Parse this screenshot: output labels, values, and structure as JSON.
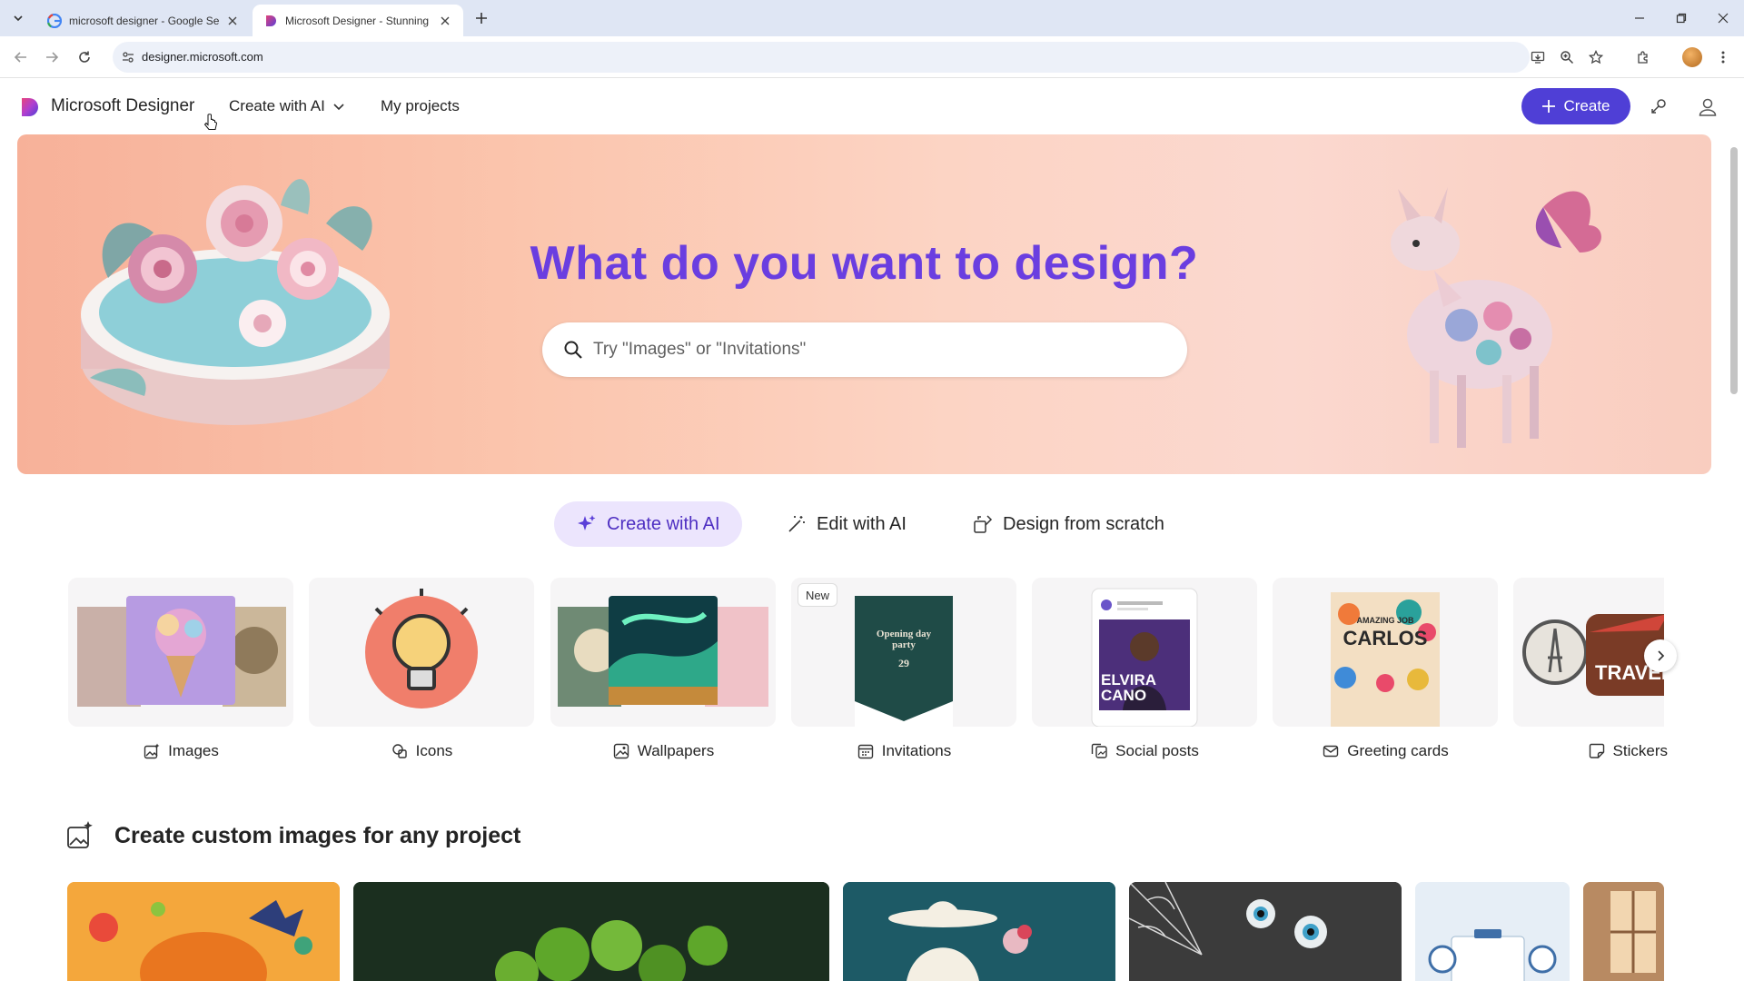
{
  "browser": {
    "tabs": [
      {
        "title": "microsoft designer - Google Se",
        "active": false,
        "favicon": "google-icon"
      },
      {
        "title": "Microsoft Designer - Stunning",
        "active": true,
        "favicon": "designer-icon"
      }
    ],
    "url": "designer.microsoft.com"
  },
  "header": {
    "app_name": "Microsoft Designer",
    "nav": {
      "create_with_ai": "Create with AI",
      "my_projects": "My projects"
    },
    "create_button": "Create"
  },
  "hero": {
    "title": "What do you want to design?",
    "search_placeholder": "Try \"Images\" or \"Invitations\""
  },
  "modes": [
    {
      "label": "Create with AI",
      "active": true,
      "icon": "sparkle-icon"
    },
    {
      "label": "Edit with AI",
      "active": false,
      "icon": "magic-wand-icon"
    },
    {
      "label": "Design from scratch",
      "active": false,
      "icon": "design-scratch-icon"
    }
  ],
  "categories": [
    {
      "label": "Images",
      "icon": "image-sparkle-icon"
    },
    {
      "label": "Icons",
      "icon": "shapes-icon"
    },
    {
      "label": "Wallpapers",
      "icon": "wallpaper-icon"
    },
    {
      "label": "Invitations",
      "icon": "calendar-icon",
      "badge": "New"
    },
    {
      "label": "Social posts",
      "icon": "social-post-icon"
    },
    {
      "label": "Greeting cards",
      "icon": "mail-icon"
    },
    {
      "label": "Stickers",
      "icon": "sticker-icon"
    }
  ],
  "card_texts": {
    "invitation_line1": "Opening day",
    "invitation_line2": "party",
    "invitation_day": "29",
    "social_name1": "ELVIRA",
    "social_name2": "CANO",
    "greeting_top": "AMAZING JOB",
    "greeting_name": "CARLOS",
    "sticker_text": "TRAVEL"
  },
  "section": {
    "title": "Create custom images for any project"
  },
  "colors": {
    "accent": "#4f3fd6",
    "hero_title": "#6a3ee0",
    "active_pill_bg": "#ece5fd"
  }
}
